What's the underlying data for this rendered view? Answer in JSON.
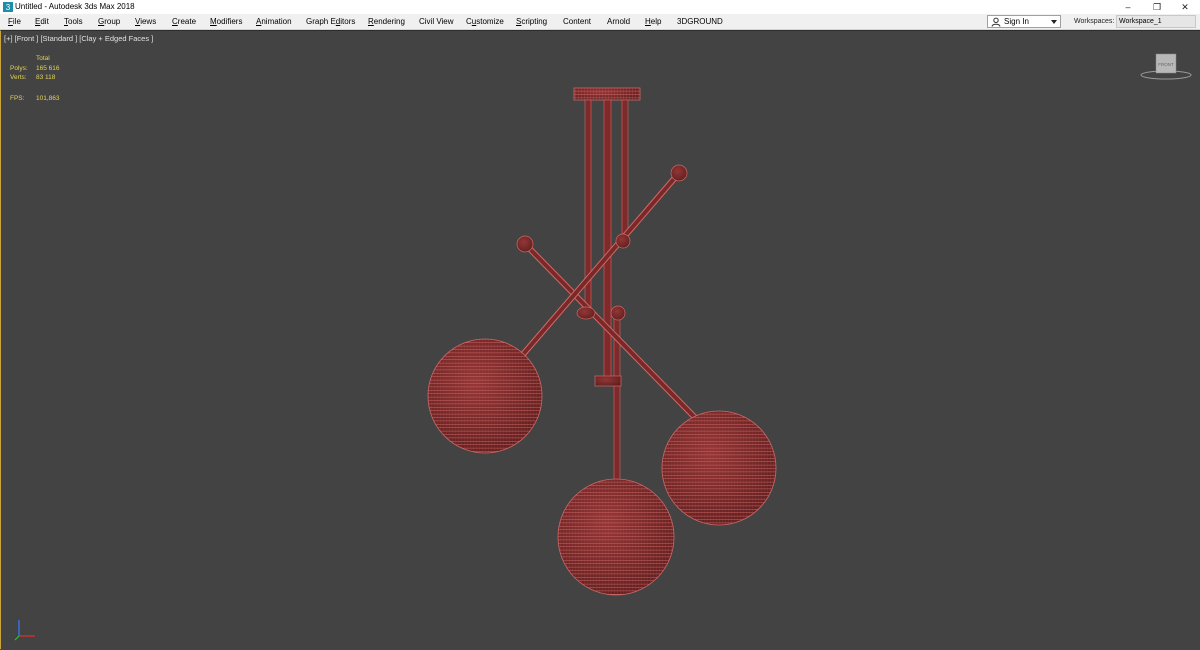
{
  "window": {
    "title": "Untitled - Autodesk 3ds Max 2018",
    "buttons": {
      "minimize": "–",
      "restore": "❐",
      "close": "✕"
    }
  },
  "menu": [
    {
      "pre": "",
      "u": "F",
      "post": "ile"
    },
    {
      "pre": "",
      "u": "E",
      "post": "dit"
    },
    {
      "pre": "",
      "u": "T",
      "post": "ools"
    },
    {
      "pre": "",
      "u": "G",
      "post": "roup"
    },
    {
      "pre": "",
      "u": "V",
      "post": "iews"
    },
    {
      "pre": "",
      "u": "C",
      "post": "reate"
    },
    {
      "pre": "",
      "u": "M",
      "post": "odifiers"
    },
    {
      "pre": "",
      "u": "A",
      "post": "nimation"
    },
    {
      "pre": "Graph E",
      "u": "d",
      "post": "itors"
    },
    {
      "pre": "",
      "u": "R",
      "post": "endering"
    },
    {
      "pre": "Civil View",
      "u": "",
      "post": ""
    },
    {
      "pre": "C",
      "u": "u",
      "post": "stomize"
    },
    {
      "pre": "",
      "u": "S",
      "post": "cripting"
    },
    {
      "pre": "Content",
      "u": "",
      "post": ""
    },
    {
      "pre": "Arnold",
      "u": "",
      "post": ""
    },
    {
      "pre": "",
      "u": "H",
      "post": "elp"
    },
    {
      "pre": "3DGROUND",
      "u": "",
      "post": ""
    }
  ],
  "account": {
    "sign_in": "Sign In"
  },
  "workspace": {
    "label": "Workspaces:",
    "value": "Workspace_1"
  },
  "viewport": {
    "label": "[+] [Front ] [Standard ] [Clay + Edged Faces ]",
    "stats": {
      "total_label": "Total",
      "polys_label": "Polys:",
      "polys_value": "165 616",
      "verts_label": "Verts:",
      "verts_value": "83 118",
      "fps_label": "FPS:",
      "fps_value": "101,863"
    },
    "viewcube_face": "FRONT"
  },
  "colors": {
    "viewport_bg": "#434343",
    "model_fill": "#8a3030",
    "model_wire": "#cf6868",
    "stats_text": "#e4d35a",
    "viewport_border": "#c9a53c"
  }
}
